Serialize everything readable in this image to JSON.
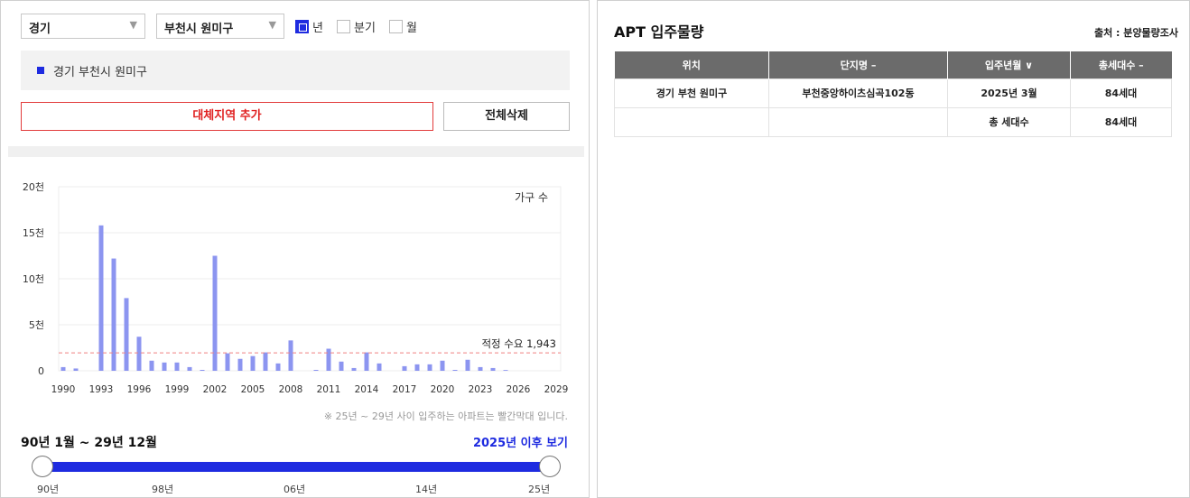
{
  "filters": {
    "province": "경기",
    "city": "부천시 원미구",
    "periods": [
      {
        "label": "년",
        "checked": true
      },
      {
        "label": "분기",
        "checked": false
      },
      {
        "label": "월",
        "checked": false
      }
    ]
  },
  "selected_region": "경기 부천시 원미구",
  "buttons": {
    "add_region": "대체지역 추가",
    "delete_all": "전체삭제"
  },
  "chart_data": {
    "type": "bar",
    "title": "",
    "series_label": "가구 수",
    "ylabel": "",
    "xlabel": "",
    "ylim": [
      0,
      20000
    ],
    "y_ticks": [
      "0",
      "5천",
      "10천",
      "15천",
      "20천"
    ],
    "y_tick_values": [
      0,
      5000,
      10000,
      15000,
      20000
    ],
    "x_ticks": [
      "1990",
      "1993",
      "1996",
      "1999",
      "2002",
      "2005",
      "2008",
      "2011",
      "2014",
      "2017",
      "2020",
      "2023",
      "2026",
      "2029"
    ],
    "x_tick_values": [
      1990,
      1993,
      1996,
      1999,
      2002,
      2005,
      2008,
      2011,
      2014,
      2017,
      2020,
      2023,
      2026,
      2029
    ],
    "x": [
      1990,
      1991,
      1992,
      1993,
      1994,
      1995,
      1996,
      1997,
      1998,
      1999,
      2000,
      2001,
      2002,
      2003,
      2004,
      2005,
      2006,
      2007,
      2008,
      2009,
      2010,
      2011,
      2012,
      2013,
      2014,
      2015,
      2016,
      2017,
      2018,
      2019,
      2020,
      2021,
      2022,
      2023,
      2024,
      2025
    ],
    "values": [
      400,
      250,
      0,
      15800,
      12200,
      7900,
      3700,
      1100,
      900,
      900,
      400,
      100,
      12500,
      1900,
      1300,
      1600,
      2000,
      800,
      3300,
      0,
      100,
      2400,
      1000,
      300,
      2000,
      800,
      0,
      500,
      700,
      700,
      1100,
      100,
      1200,
      400,
      300,
      84
    ],
    "reference_line": {
      "label": "적정 수요 1,943",
      "value": 1943
    },
    "colors": {
      "bar": "#8c95f0",
      "reference": "#f08080"
    }
  },
  "note": "※ 25년 ~ 29년 사이 입주하는 아파트는 빨간막대 입니다.",
  "period_range": "90년 1월 ~ 29년 12월",
  "future_link": "2025년 이후 보기",
  "slider_labels": [
    "90년",
    "98년",
    "06년",
    "14년",
    "25년"
  ],
  "right": {
    "title": "APT 입주물량",
    "source": "출처 : 분양물량조사",
    "columns": [
      "위치",
      "단지명 –",
      "입주년월 ∨",
      "총세대수 –"
    ],
    "rows": [
      [
        "경기 부천 원미구",
        "부천중앙하이츠심곡102동",
        "2025년 3월",
        "84세대"
      ],
      [
        "",
        "",
        "총 세대수",
        "84세대"
      ]
    ]
  },
  "colors": {
    "accent": "#1e2be0",
    "danger": "#e02020",
    "header_gray": "#6b6b6b"
  }
}
